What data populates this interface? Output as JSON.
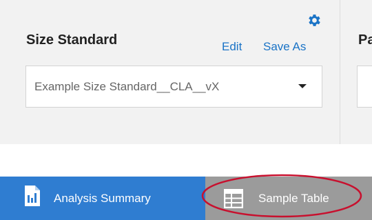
{
  "colors": {
    "panel_bg": "#f2f2f2",
    "link": "#1a73c6",
    "active_tab": "#2f7dd1",
    "inactive_tab": "#9b9b9b",
    "highlight_ring": "#c8102e"
  },
  "size_standard": {
    "title": "Size Standard",
    "edit_label": "Edit",
    "save_as_label": "Save As",
    "selected_value": "Example Size Standard__CLA__vX",
    "settings_icon": "gear-icon",
    "dropdown_icon": "caret-down-icon"
  },
  "next_section": {
    "title_fragment": "Pa"
  },
  "tabs": [
    {
      "label": "Analysis Summary",
      "icon": "report-document-icon",
      "active": true
    },
    {
      "label": "Sample Table",
      "icon": "table-icon",
      "active": false
    }
  ]
}
